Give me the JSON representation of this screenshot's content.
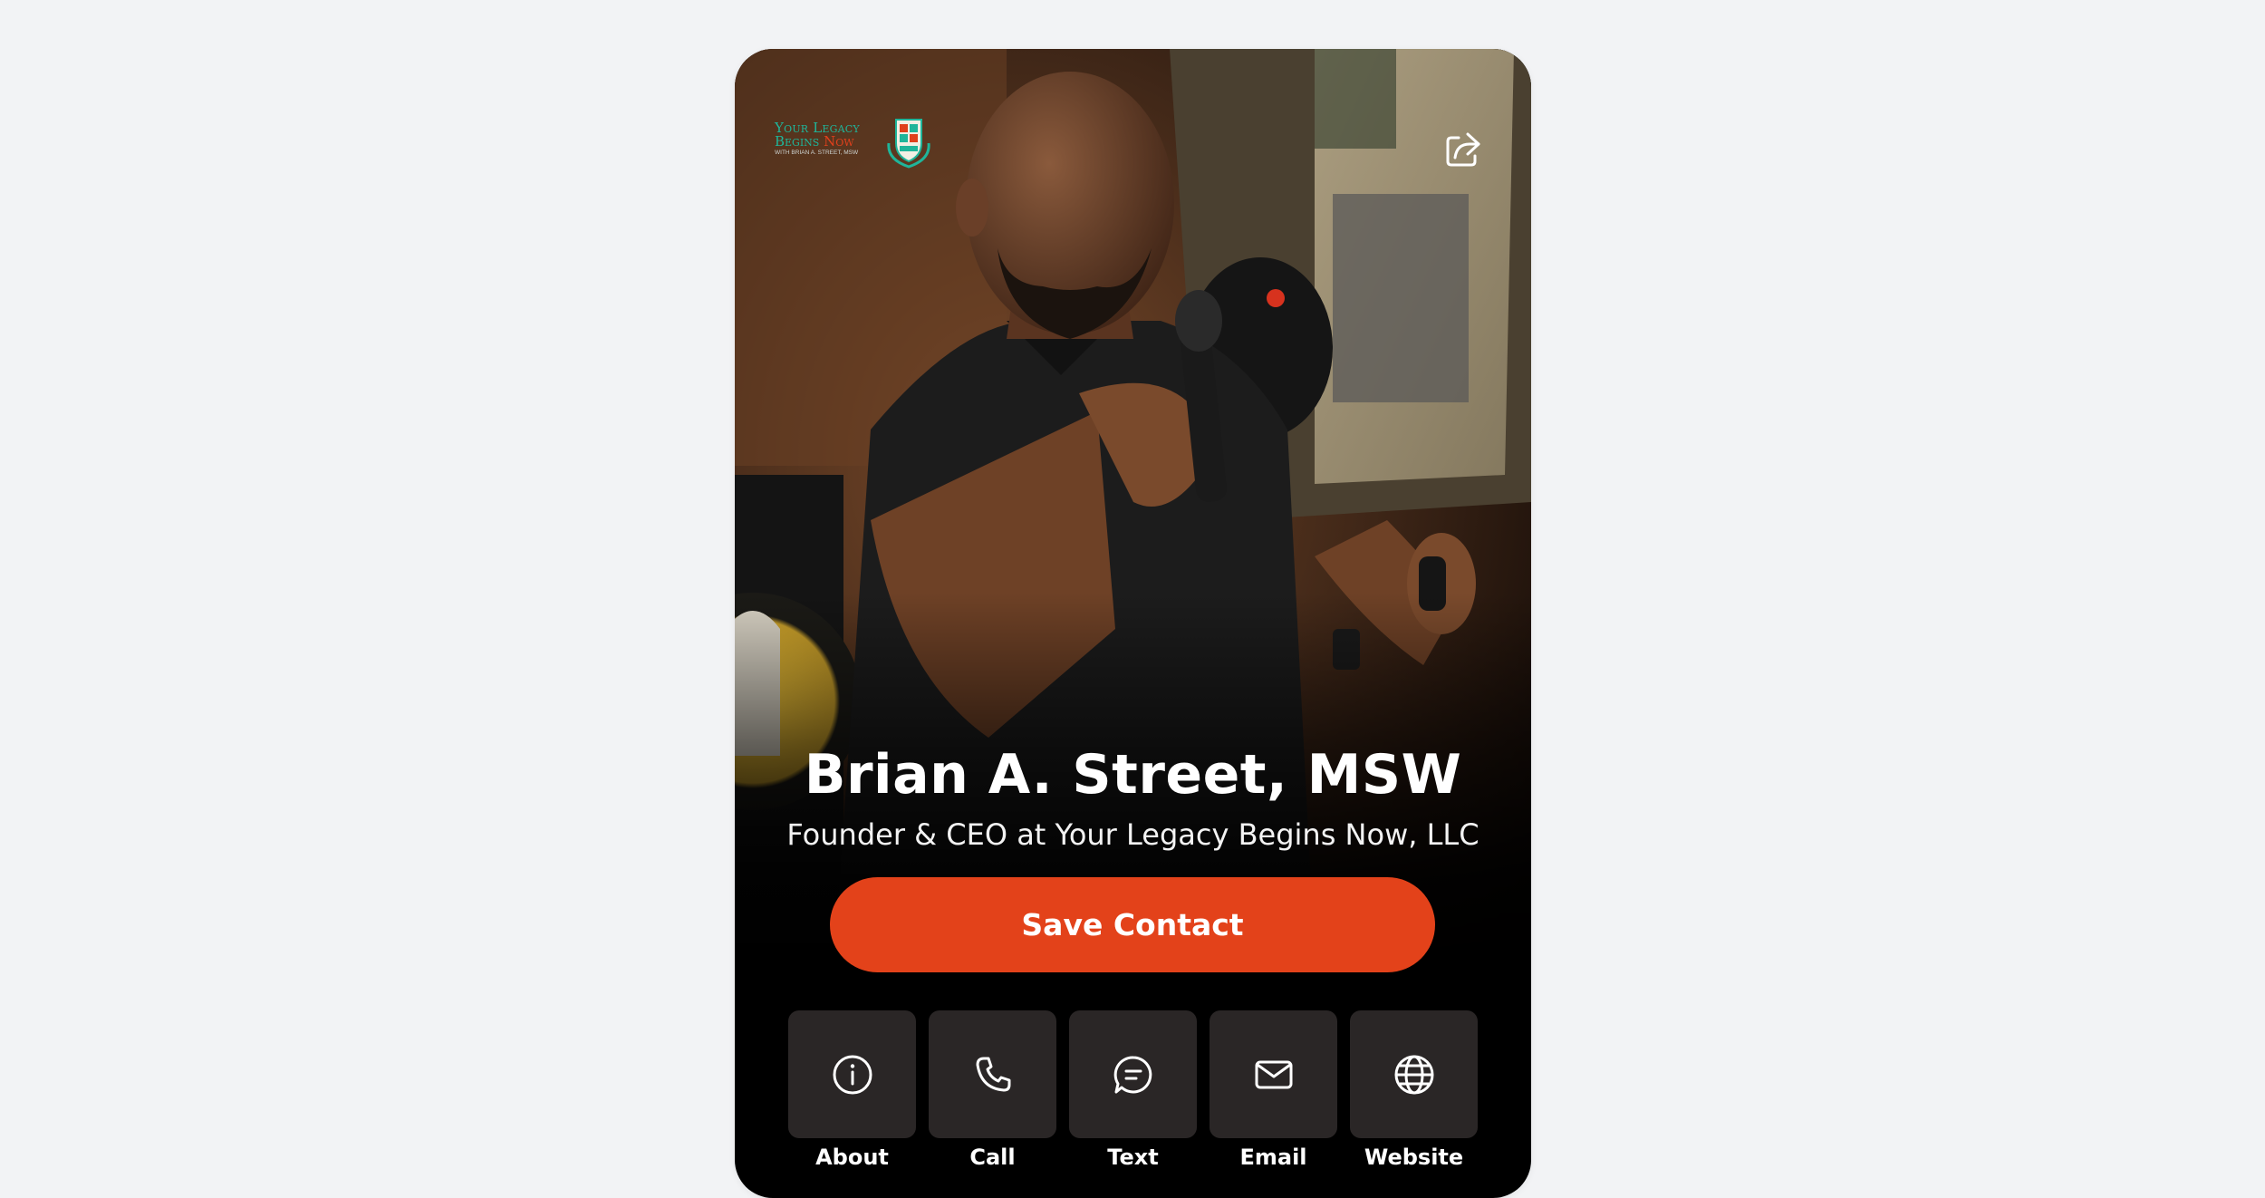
{
  "profile": {
    "name": "Brian A. Street, MSW",
    "title": "Founder & CEO at Your Legacy Begins Now, LLC"
  },
  "logo": {
    "line1": "Your Legacy",
    "line2_begins": "Begins",
    "line2_now": "Now",
    "line3": "WITH BRIAN A. STREET, MSW"
  },
  "buttons": {
    "save_contact": "Save Contact"
  },
  "actions": [
    {
      "label": "About",
      "icon": "info-icon"
    },
    {
      "label": "Call",
      "icon": "phone-icon"
    },
    {
      "label": "Text",
      "icon": "message-icon"
    },
    {
      "label": "Email",
      "icon": "mail-icon"
    },
    {
      "label": "Website",
      "icon": "globe-icon"
    }
  ],
  "colors": {
    "accent": "#e3421a",
    "tile": "#2a2626",
    "page_background": "#f2f3f5",
    "card_background": "#000000"
  }
}
